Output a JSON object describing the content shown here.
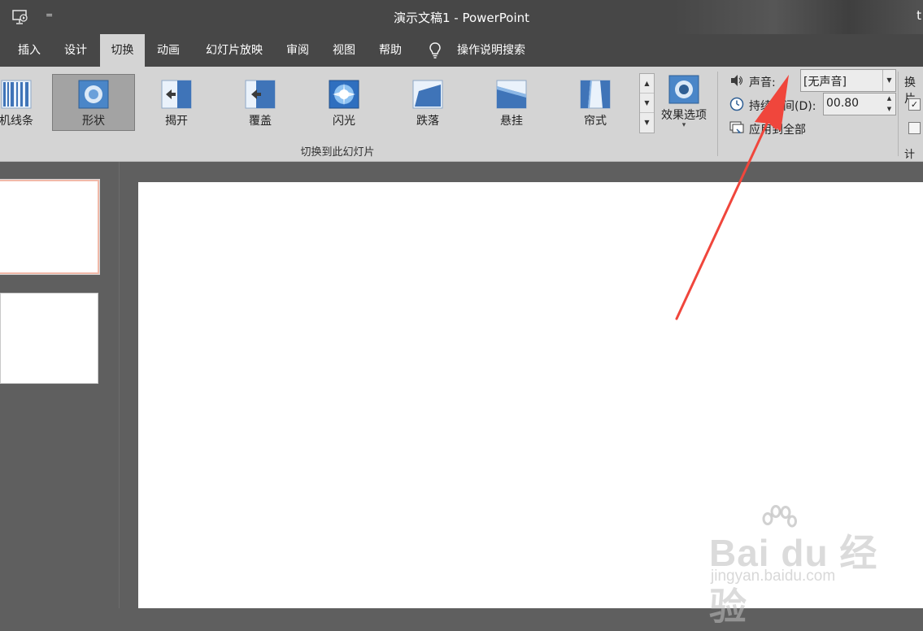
{
  "window": {
    "title": "演示文稿1  -  PowerPoint",
    "user_partial": "t",
    "qat_more": "="
  },
  "tabs": [
    {
      "label": "插入"
    },
    {
      "label": "设计"
    },
    {
      "label": "切换",
      "active": true
    },
    {
      "label": "动画"
    },
    {
      "label": "幻灯片放映"
    },
    {
      "label": "审阅"
    },
    {
      "label": "视图"
    },
    {
      "label": "帮助"
    },
    {
      "label": "操作说明搜索"
    }
  ],
  "gallery": {
    "items": [
      {
        "label": "机线条",
        "icon": "random-bars-icon"
      },
      {
        "label": "形状",
        "icon": "shape-icon",
        "selected": true
      },
      {
        "label": "揭开",
        "icon": "uncover-icon"
      },
      {
        "label": "覆盖",
        "icon": "cover-icon"
      },
      {
        "label": "闪光",
        "icon": "flash-icon"
      },
      {
        "label": "跌落",
        "icon": "fall-over-icon"
      },
      {
        "label": "悬挂",
        "icon": "drape-icon"
      },
      {
        "label": "帘式",
        "icon": "curtains-icon"
      }
    ],
    "scroll": {
      "up": "▲",
      "down": "▼",
      "more": "▼"
    },
    "group_label": "切换到此幻灯片"
  },
  "effect_options": {
    "label": "效果选项",
    "caret": "▾"
  },
  "timing": {
    "sound_label": "声音:",
    "sound_value": "[无声音]",
    "duration_label": "持续时间(D):",
    "duration_value": "00.80",
    "apply_all_label": "应用到全部",
    "advance_label_partial": "换片",
    "group_label_partial": "计时"
  },
  "watermark": {
    "main": "Bai du 经验",
    "sub": "jingyan.baidu.com"
  },
  "colors": {
    "titlebar": "#474747",
    "ribbon": "#d4d4d4",
    "workspace": "#5f5f5f",
    "annotation_arrow": "#f0463c",
    "selected_thumb_border": "#f1b9a9"
  }
}
